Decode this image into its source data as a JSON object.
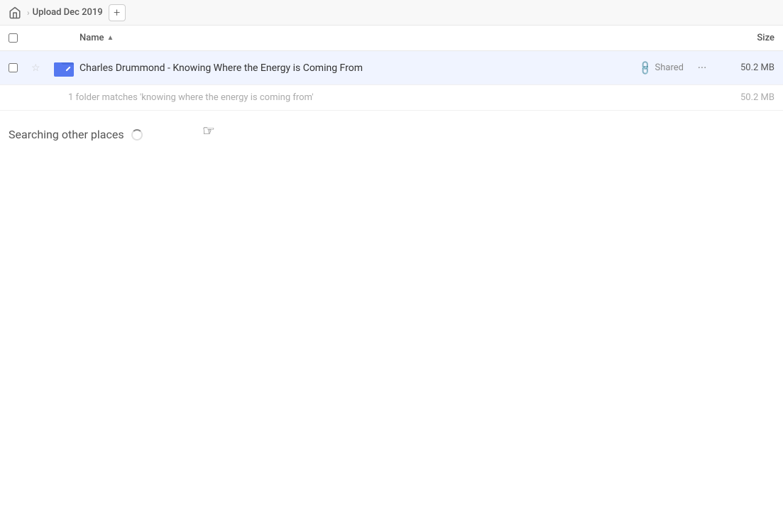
{
  "breadcrumb": {
    "home_icon": "home",
    "folder_label": "Upload Dec 2019",
    "add_label": "+"
  },
  "columns": {
    "name_label": "Name",
    "sort_arrow": "▲",
    "size_label": "Size"
  },
  "file_row": {
    "name": "Charles Drummond - Knowing Where the Energy is Coming From",
    "shared_label": "Shared",
    "size": "50.2 MB"
  },
  "match_row": {
    "text": "1 folder matches 'knowing where the energy is coming from'",
    "size": "50.2 MB"
  },
  "searching": {
    "label": "Searching other places"
  }
}
